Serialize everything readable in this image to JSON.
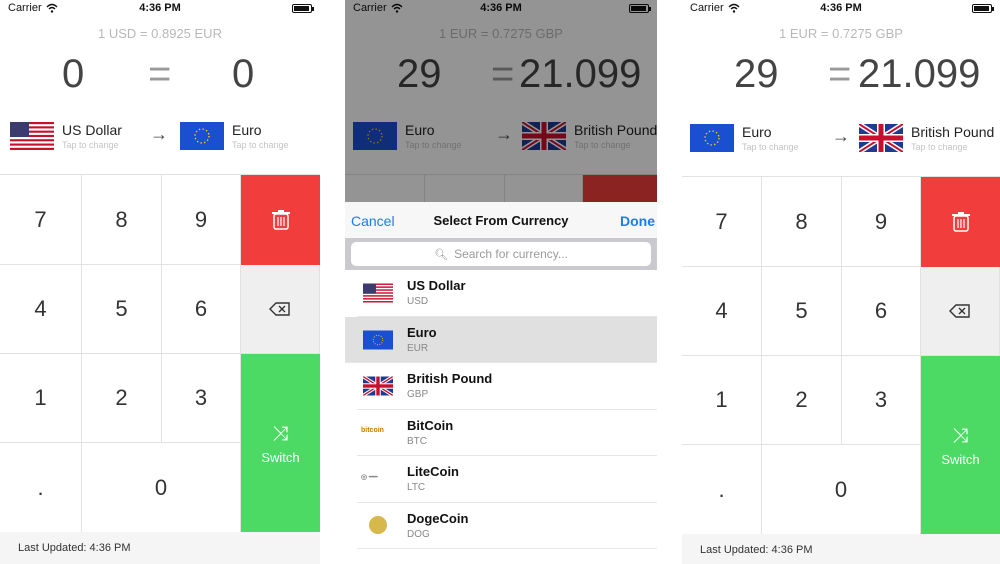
{
  "colors": {
    "delete": "#f23d3d",
    "switch": "#4cd964",
    "accent": "#1a7cf0"
  },
  "status": {
    "carrier": "Carrier",
    "time": "4:36 PM"
  },
  "screen1": {
    "rate": "1 USD = 0.8925 EUR",
    "from_amount": "0",
    "equals": "=",
    "to_amount": "0",
    "from_currency": "US Dollar",
    "to_currency": "Euro",
    "tap_hint": "Tap to change",
    "keys": {
      "k7": "7",
      "k8": "8",
      "k9": "9",
      "k4": "4",
      "k5": "5",
      "k6": "6",
      "k1": "1",
      "k2": "2",
      "k3": "3",
      "dot": ".",
      "k0": "0"
    },
    "switch_label": "Switch",
    "footer": "Last Updated: 4:36 PM"
  },
  "screen2": {
    "rate": "1 EUR = 0.7275 GBP",
    "from_amount": "29",
    "equals": "=",
    "to_amount": "21.099",
    "from_currency": "Euro",
    "to_currency": "British Pound",
    "tap_hint": "Tap to change",
    "sheet": {
      "cancel": "Cancel",
      "title": "Select From Currency",
      "done": "Done",
      "search_placeholder": "Search for currency..."
    },
    "currencies": [
      {
        "name": "US Dollar",
        "code": "USD",
        "icon": "us-flag"
      },
      {
        "name": "Euro",
        "code": "EUR",
        "icon": "eu-flag",
        "selected": true
      },
      {
        "name": "British Pound",
        "code": "GBP",
        "icon": "uk-flag"
      },
      {
        "name": "BitCoin",
        "code": "BTC",
        "icon": "bitcoin-logo",
        "logo_text": "bitcoin"
      },
      {
        "name": "LiteCoin",
        "code": "LTC",
        "icon": "litecoin-logo"
      },
      {
        "name": "DogeCoin",
        "code": "DOG",
        "icon": "dogecoin-logo"
      }
    ]
  },
  "screen3": {
    "rate": "1 EUR = 0.7275 GBP",
    "from_amount": "29",
    "equals": "=",
    "to_amount": "21.099",
    "from_currency": "Euro",
    "to_currency": "British Pound",
    "tap_hint": "Tap to change",
    "keys": {
      "k7": "7",
      "k8": "8",
      "k9": "9",
      "k4": "4",
      "k5": "5",
      "k6": "6",
      "k1": "1",
      "k2": "2",
      "k3": "3",
      "dot": ".",
      "k0": "0"
    },
    "switch_label": "Switch",
    "footer": "Last Updated: 4:36 PM"
  }
}
